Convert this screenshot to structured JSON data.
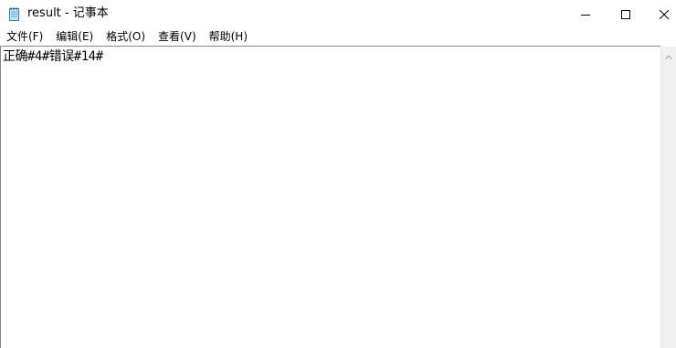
{
  "window": {
    "title": "result - 记事本"
  },
  "caption_buttons": {
    "minimize_icon": "minimize-icon",
    "maximize_icon": "maximize-icon",
    "close_icon": "close-icon"
  },
  "menu": {
    "items": [
      {
        "label": "文件(F)"
      },
      {
        "label": "编辑(E)"
      },
      {
        "label": "格式(O)"
      },
      {
        "label": "查看(V)"
      },
      {
        "label": "帮助(H)"
      }
    ]
  },
  "editor": {
    "content": "正确#4#错误#14#"
  },
  "colors": {
    "border": "#828790",
    "scrollbar_bg": "#f0f0f0"
  }
}
